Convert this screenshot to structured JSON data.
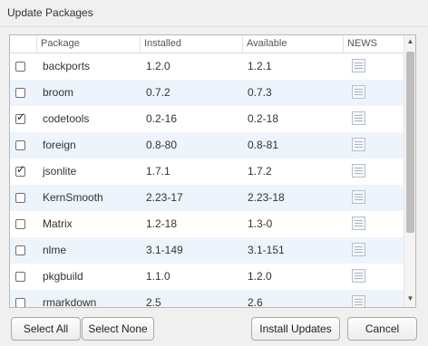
{
  "window": {
    "title": "Update Packages"
  },
  "table": {
    "columns": [
      "",
      "Package",
      "Installed",
      "Available",
      "NEWS"
    ],
    "rows": [
      {
        "checked": false,
        "package": "backports",
        "installed": "1.2.0",
        "available": "1.2.1"
      },
      {
        "checked": false,
        "package": "broom",
        "installed": "0.7.2",
        "available": "0.7.3"
      },
      {
        "checked": true,
        "package": "codetools",
        "installed": "0.2-16",
        "available": "0.2-18"
      },
      {
        "checked": false,
        "package": "foreign",
        "installed": "0.8-80",
        "available": "0.8-81"
      },
      {
        "checked": true,
        "package": "jsonlite",
        "installed": "1.7.1",
        "available": "1.7.2"
      },
      {
        "checked": false,
        "package": "KernSmooth",
        "installed": "2.23-17",
        "available": "2.23-18"
      },
      {
        "checked": false,
        "package": "Matrix",
        "installed": "1.2-18",
        "available": "1.3-0"
      },
      {
        "checked": false,
        "package": "nlme",
        "installed": "3.1-149",
        "available": "3.1-151"
      },
      {
        "checked": false,
        "package": "pkgbuild",
        "installed": "1.1.0",
        "available": "1.2.0"
      },
      {
        "checked": false,
        "package": "rmarkdown",
        "installed": "2.5",
        "available": "2.6"
      }
    ],
    "checkmark_glyph": "✓",
    "news_icon": "document-icon"
  },
  "scrollbar": {
    "up_glyph": "▲",
    "down_glyph": "▼"
  },
  "buttons": {
    "select_all": "Select All",
    "select_none": "Select None",
    "install_updates": "Install Updates",
    "cancel": "Cancel"
  },
  "colors": {
    "row_alt": "#eef4fb",
    "background": "#f0f0f0"
  }
}
